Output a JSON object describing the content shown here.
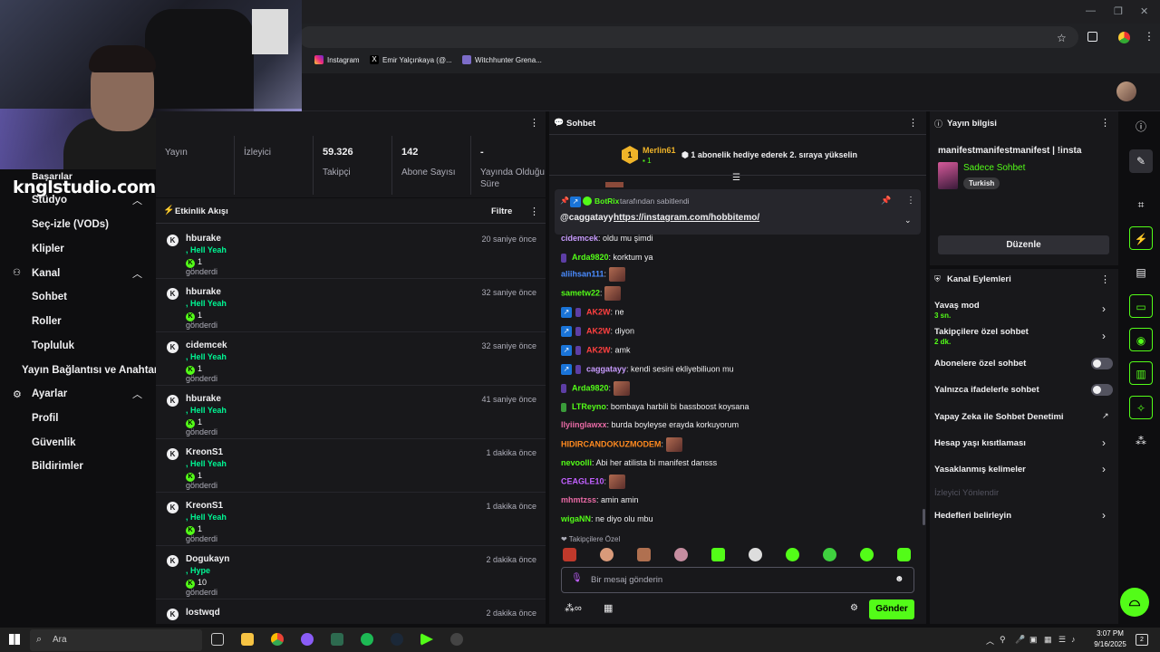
{
  "browser": {
    "bookmarks": [
      "Instagram",
      "Emir Yalçınkaya (@...",
      "Witchhunter Grena..."
    ],
    "window_controls": [
      "—",
      "❐",
      "✕"
    ]
  },
  "watermark": "knglstudio.com",
  "nav": {
    "top_partial": "Başarılar",
    "studio_label": "Stüdyo",
    "items_studio": [
      "Seç-izle (VODs)",
      "Klipler"
    ],
    "kanal_label": "Kanal",
    "items_kanal": [
      "Sohbet",
      "Roller",
      "Topluluk",
      "Yayın Bağlantısı ve Anahtarı"
    ],
    "ayarlar_label": "Ayarlar",
    "items_ayarlar": [
      "Profil",
      "Güvenlik",
      "Bildirimler"
    ]
  },
  "stats": [
    {
      "value": "",
      "label": "Yayın"
    },
    {
      "value": "",
      "label": "İzleyici"
    },
    {
      "value": "59.326",
      "label": "Takipçi"
    },
    {
      "value": "142",
      "label": "Abone Sayısı"
    },
    {
      "value": "-",
      "label": "Yayında Olduğu Süre"
    }
  ],
  "activity": {
    "title": "Etkinlik Akışı",
    "filter": "Filtre",
    "rows": [
      {
        "user": "hburake",
        "emote": ", Hell Yeah",
        "count": "1",
        "sent": "gönderdi",
        "time": "20 saniye önce"
      },
      {
        "user": "hburake",
        "emote": ", Hell Yeah",
        "count": "1",
        "sent": "gönderdi",
        "time": "32 saniye önce"
      },
      {
        "user": "cidemcek",
        "emote": ", Hell Yeah",
        "count": "1",
        "sent": "gönderdi",
        "time": "32 saniye önce"
      },
      {
        "user": "hburake",
        "emote": ", Hell Yeah",
        "count": "1",
        "sent": "gönderdi",
        "time": "41 saniye önce"
      },
      {
        "user": "KreonS1",
        "emote": ", Hell Yeah",
        "count": "1",
        "sent": "gönderdi",
        "time": "1 dakika önce"
      },
      {
        "user": "KreonS1",
        "emote": ", Hell Yeah",
        "count": "1",
        "sent": "gönderdi",
        "time": "1 dakika önce"
      },
      {
        "user": "Dogukayn",
        "emote": ", Hype",
        "count": "10",
        "sent": "gönderdi",
        "time": "2 dakika önce"
      },
      {
        "user": "lostwqd",
        "emote": "",
        "count": "",
        "sent": "",
        "time": "2 dakika önce"
      }
    ]
  },
  "chat": {
    "title": "Sohbet",
    "gift_user": "Merlin61",
    "gift_rank": "1",
    "gift_count": "1",
    "gift_text": "1 abonelik hediye ederek 2. sıraya yükselin",
    "pinned_by_user": "BotRix",
    "pinned_by_text": "tarafından sabitlendi",
    "pinned_mention": "@caggatayy",
    "pinned_link": "https://instagram.com/hobbitemo/",
    "messages": [
      {
        "user": "cidemcek",
        "text": "oldu mu şimdi",
        "color": "#c99cff"
      },
      {
        "user": "Arda9820",
        "text": "korktum ya",
        "color": "#53fc18"
      },
      {
        "user": "aliihsan111",
        "text": "",
        "color": "#4a8cff"
      },
      {
        "user": "sametw22",
        "text": "",
        "color": "#53fc18"
      },
      {
        "user": "AK2W",
        "text": "ne",
        "color": "#ff4040"
      },
      {
        "user": "AK2W",
        "text": "diyon",
        "color": "#ff4040"
      },
      {
        "user": "AK2W",
        "text": "amk",
        "color": "#ff4040"
      },
      {
        "user": "caggatayy",
        "text": "kendi sesini ekliyebiliuon mu",
        "color": "#c99cff"
      },
      {
        "user": "Arda9820",
        "text": "",
        "color": "#53fc18"
      },
      {
        "user": "LTReyno",
        "text": "bombaya harbili bi bassboost koysana",
        "color": "#53fc18"
      },
      {
        "user": "llyiinglawxx",
        "text": "burda boyleyse erayda korkuyorum",
        "color": "#e86aa5"
      },
      {
        "user": "HIDIRCANDOKUZMODEM",
        "text": "",
        "color": "#ff8a1f"
      },
      {
        "user": "nevoolli",
        "text": "Abi her atilista bi manifest dansss",
        "color": "#53fc18"
      },
      {
        "user": "CEAGLE10",
        "text": "",
        "color": "#c260ff"
      },
      {
        "user": "mhmtzss",
        "text": "amin amin",
        "color": "#e86aa5"
      },
      {
        "user": "wigaNN",
        "text": "ne diyo olu mbu",
        "color": "#53fc18"
      }
    ],
    "followers_only": "Takipçilere Özel",
    "input_placeholder": "Bir mesaj gönderin",
    "send": "Gönder"
  },
  "info": {
    "title": "Yayın bilgisi",
    "stream_title": "manifestmanifestmanifest | !insta",
    "category": "Sadece Sohbet",
    "tag": "Turkish",
    "edit": "Düzenle"
  },
  "actions": {
    "title": "Kanal Eylemleri",
    "slow_mode": "Yavaş mod",
    "slow_mode_val": "3 sn.",
    "followers_chat": "Takipçilere özel sohbet",
    "followers_chat_val": "2 dk.",
    "subs_chat": "Abonelere özel sohbet",
    "emote_chat": "Yalnızca ifadelerle sohbet",
    "ai_mod": "Yapay Zeka ile Sohbet Denetimi",
    "age_restrict": "Hesap yaşı kısıtlaması",
    "banned_words": "Yasaklanmış kelimeler",
    "redirect": "İzleyici Yönlendir",
    "goals": "Hedefleri belirleyin"
  },
  "taskbar": {
    "search": "Ara",
    "time": "3:07 PM",
    "date": "9/16/2025",
    "notif": "2"
  },
  "colors": {
    "accent": "#53fc18",
    "panel": "#18181b",
    "bg": "#0e0e10"
  }
}
